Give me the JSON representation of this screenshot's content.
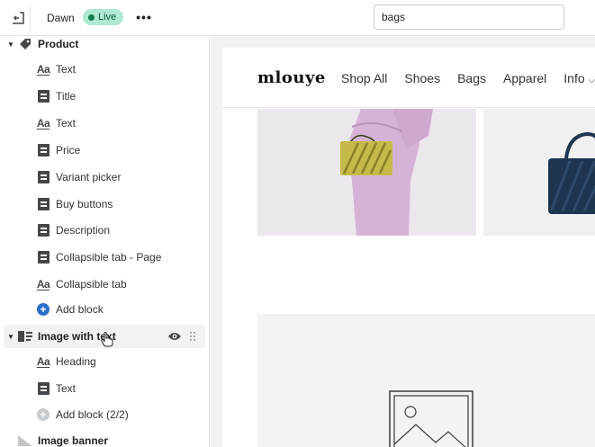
{
  "topbar": {
    "theme_name": "Dawn",
    "live_label": "Live",
    "more_label": "•••",
    "search_value": "bags"
  },
  "sidebar": {
    "sections": [
      {
        "label": "Product",
        "blocks": [
          {
            "label": "Text",
            "icon": "text-icon"
          },
          {
            "label": "Title",
            "icon": "doc-icon"
          },
          {
            "label": "Text",
            "icon": "text-icon"
          },
          {
            "label": "Price",
            "icon": "doc-icon"
          },
          {
            "label": "Variant picker",
            "icon": "doc-icon"
          },
          {
            "label": "Buy buttons",
            "icon": "doc-icon"
          },
          {
            "label": "Description",
            "icon": "doc-icon"
          },
          {
            "label": "Collapsible tab - Page",
            "icon": "doc-icon"
          },
          {
            "label": "Collapsible tab",
            "icon": "text-icon"
          }
        ],
        "add_block": "Add block"
      },
      {
        "label": "Image with text",
        "blocks": [
          {
            "label": "Heading",
            "icon": "text-icon"
          },
          {
            "label": "Text",
            "icon": "doc-icon"
          }
        ],
        "add_block": "Add block (2/2)"
      },
      {
        "label": "Image banner",
        "blocks": []
      }
    ]
  },
  "preview": {
    "logo": "mlouye",
    "nav": [
      "Shop All",
      "Shoes",
      "Bags",
      "Apparel",
      "Info"
    ]
  },
  "colors": {
    "accent_blue": "#2c6ecb",
    "live_badge_bg": "#aee9d1",
    "live_badge_text": "#0d5c3a",
    "bag_yellow": "#c6b94a",
    "bag_navy": "#1e3550",
    "model_pink": "#d9b6d9"
  }
}
